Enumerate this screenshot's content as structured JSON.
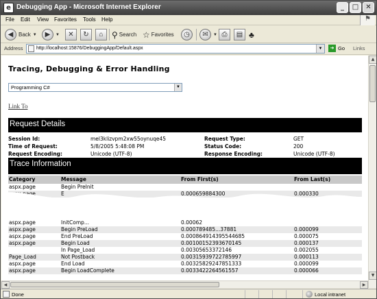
{
  "window": {
    "title": "Debugging App - Microsoft Internet Explorer",
    "minimize_glyph": "_",
    "maximize_glyph": "□",
    "close_glyph": "✕"
  },
  "menu": [
    "File",
    "Edit",
    "View",
    "Favorites",
    "Tools",
    "Help"
  ],
  "toolbar": {
    "back_label": "Back",
    "search_label": "Search",
    "favorites_label": "Favorites"
  },
  "address": {
    "label": "Address",
    "url": "http://localhost:15876/DebuggingApp/Default.aspx",
    "go_label": "Go",
    "links_label": "Links"
  },
  "page": {
    "heading": "Tracing, Debugging & Error Handling",
    "select_value": "Programming C#",
    "link_text": "Link To"
  },
  "request_details": {
    "title": "Request Details",
    "session_id_label": "Session Id:",
    "session_id": "mel3klizvpm2xw55oynuqe45",
    "time_label": "Time of Request:",
    "time": "5/8/2005 5:48:08 PM",
    "req_enc_label": "Request Encoding:",
    "req_enc": "Unicode (UTF-8)",
    "request_type_label": "Request Type:",
    "request_type": "GET",
    "status_code_label": "Status Code:",
    "status_code": "200",
    "resp_enc_label": "Response Encoding:",
    "resp_enc": "Unicode (UTF-8)"
  },
  "trace": {
    "title": "Trace Information",
    "headers": [
      "Category",
      "Message",
      "From First(s)",
      "From Last(s)"
    ],
    "rows_top": [
      {
        "category": "aspx.page",
        "message": "Begin PreInit",
        "first": "",
        "last": ""
      },
      {
        "category": "aspx.page",
        "message": "E",
        "first": "0.000659884300",
        "last": "0.000330"
      }
    ],
    "rows_bottom": [
      {
        "category": "aspx.page",
        "message": "InitComp...",
        "first": "0.00062",
        "last": ""
      },
      {
        "category": "aspx.page",
        "message": "Begin PreLoad",
        "first": "0.000789485...37881",
        "last": "0.000099"
      },
      {
        "category": "aspx.page",
        "message": "End PreLoad",
        "first": "0.000864914395544685",
        "last": "0.000075"
      },
      {
        "category": "aspx.page",
        "message": "Begin Load",
        "first": "0.00100152393670145",
        "last": "0.000137"
      },
      {
        "category": "",
        "message": "In Page_Load",
        "first": "0.00305653372146",
        "last": "0.002055"
      },
      {
        "category": "Page_Load",
        "message": "Not Postback",
        "first": "0.00315939722785997",
        "last": "0.000113"
      },
      {
        "category": "aspx.page",
        "message": "End Load",
        "first": "0.00325829247851333",
        "last": "0.000099"
      },
      {
        "category": "aspx.page",
        "message": "Begin LoadComplete",
        "first": "0.0033422264561557",
        "last": "0.000066"
      }
    ]
  },
  "status": {
    "done": "Done",
    "zone": "Local intranet"
  }
}
